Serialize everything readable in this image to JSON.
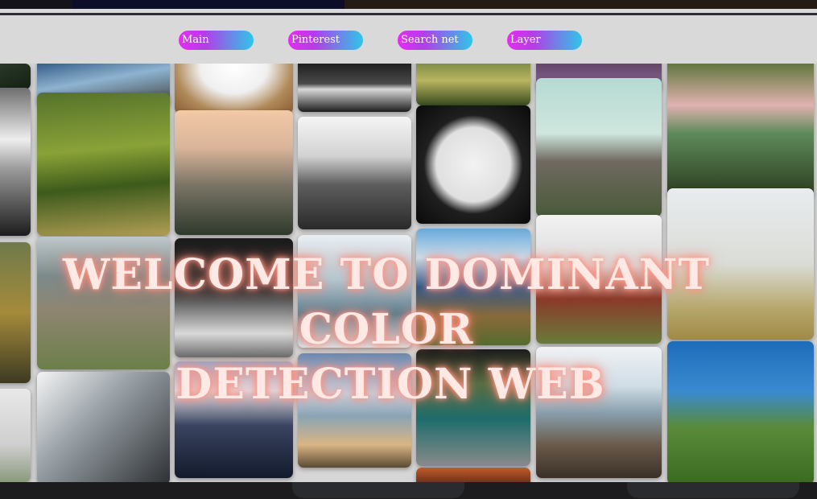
{
  "nav": {
    "items": [
      {
        "label": "Main"
      },
      {
        "label": "Pinterest"
      },
      {
        "label": "Search net"
      },
      {
        "label": "Layer"
      }
    ]
  },
  "hero": {
    "title_line1": "WELCOME TO DOMINANT COLOR",
    "title_line2": "DETECTION WEB"
  },
  "gallery": {
    "images": [
      "dark-forest-edge",
      "mountain-sky-view",
      "coffee-cup",
      "typewriter-keys",
      "ivy-leaves",
      "purple-flowers",
      "black-white-clouds",
      "green-forest-path",
      "mountain-sunrise-cliff",
      "bw-hill-fence-path",
      "bw-clock-face",
      "old-concrete-bunker",
      "hands-holding-pine-sprouts",
      "wooden-boardwalk-beach",
      "person-standing-jeans",
      "glass-skyscraper",
      "coastal-bay-cliffs",
      "misty-temple-trees",
      "foggy-field",
      "skyscraper-from-below",
      "night-ocean-waves",
      "beach-stairs-sunset",
      "vintage-car-interior",
      "rocky-shoreline",
      "aerial-coast-forest"
    ]
  },
  "colors": {
    "accent_gradient_start": "#e52df0",
    "accent_gradient_end": "#2ec6e8",
    "title_glow": "#ff8a7a"
  }
}
